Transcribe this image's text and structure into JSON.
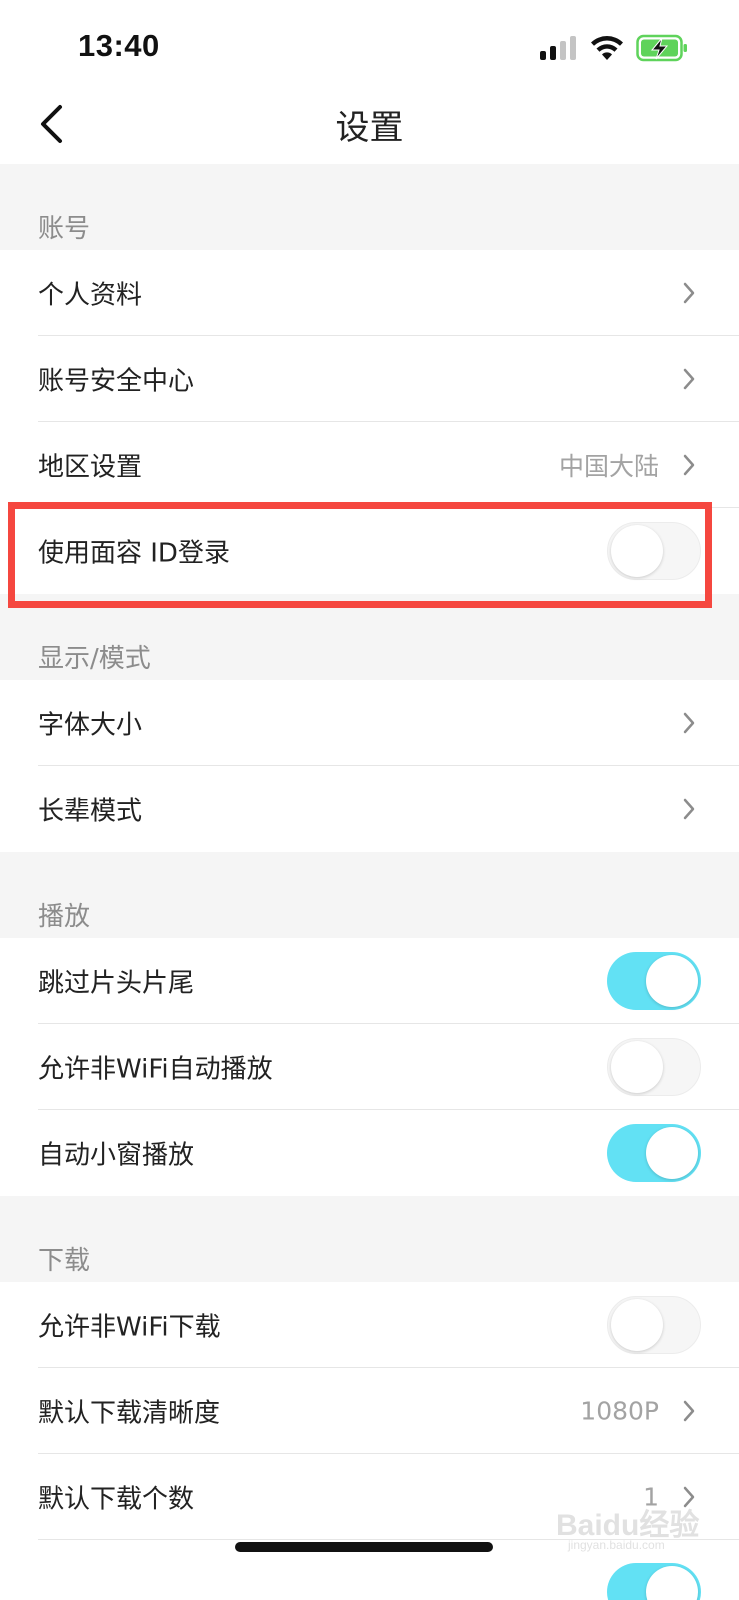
{
  "status_bar": {
    "time": "13:40"
  },
  "header": {
    "title": "设置"
  },
  "sections": [
    {
      "title": "账号",
      "items": [
        {
          "label": "个人资料",
          "type": "link"
        },
        {
          "label": "账号安全中心",
          "type": "link"
        },
        {
          "label": "地区设置",
          "type": "link",
          "value": "中国大陆"
        },
        {
          "label": "使用面容 ID登录",
          "type": "toggle",
          "on": false
        }
      ]
    },
    {
      "title": "显示/模式",
      "items": [
        {
          "label": "字体大小",
          "type": "link"
        },
        {
          "label": "长辈模式",
          "type": "link"
        }
      ]
    },
    {
      "title": "播放",
      "items": [
        {
          "label": "跳过片头片尾",
          "type": "toggle",
          "on": true
        },
        {
          "label": "允许非WiFi自动播放",
          "type": "toggle",
          "on": false
        },
        {
          "label": "自动小窗播放",
          "type": "toggle",
          "on": true
        }
      ]
    },
    {
      "title": "下载",
      "items": [
        {
          "label": "允许非WiFi下载",
          "type": "toggle",
          "on": false
        },
        {
          "label": "默认下载清晰度",
          "type": "link",
          "value": "1080P"
        },
        {
          "label": "默认下载个数",
          "type": "link",
          "value": "1"
        }
      ]
    }
  ],
  "watermark": {
    "text": "Baidu经验",
    "subtext": "jingyan.baidu.com"
  },
  "colors": {
    "toggle_on": "#62e1f4",
    "highlight": "#f5473f",
    "battery": "#5fd35b"
  }
}
